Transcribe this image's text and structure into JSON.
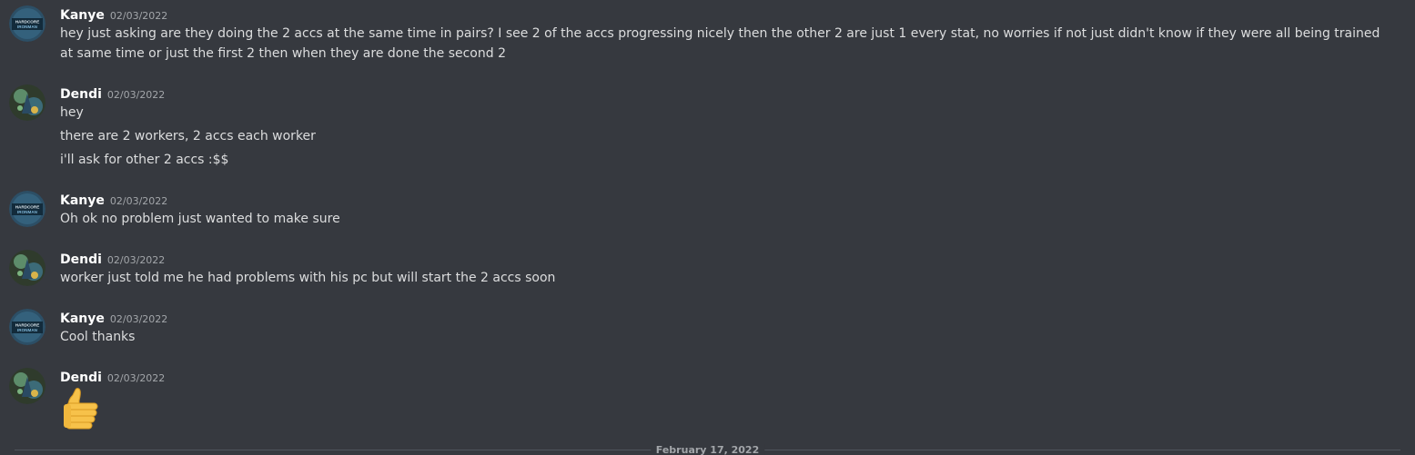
{
  "messages": [
    {
      "author": "Kanye",
      "timestamp": "02/03/2022",
      "avatar": "hardcore-ironman-icon",
      "lines": [
        "hey just asking are they doing the 2 accs at the same time in pairs? I see 2 of the accs progressing nicely then the other 2 are just 1 every stat, no worries if not just didn't know if they were all being trained at same time or just the first 2 then when they are done the second 2"
      ]
    },
    {
      "author": "Dendi",
      "timestamp": "02/03/2022",
      "avatar": "character-avatar",
      "lines": [
        "hey",
        "there are 2 workers, 2 accs each worker",
        "i'll ask for other 2 accs :$$"
      ]
    },
    {
      "author": "Kanye",
      "timestamp": "02/03/2022",
      "avatar": "hardcore-ironman-icon",
      "lines": [
        "Oh ok no problem just wanted to make sure"
      ]
    },
    {
      "author": "Dendi",
      "timestamp": "02/03/2022",
      "avatar": "character-avatar",
      "lines": [
        "worker just told me he had problems with his pc but will start the 2 accs soon"
      ]
    },
    {
      "author": "Kanye",
      "timestamp": "02/03/2022",
      "avatar": "hardcore-ironman-icon",
      "lines": [
        "Cool thanks"
      ]
    },
    {
      "author": "Dendi",
      "timestamp": "02/03/2022",
      "avatar": "character-avatar",
      "emoji": "thumbs-up-icon"
    }
  ],
  "avatar_text": {
    "line1": "HARDCORE",
    "line2": "IRONMAN"
  },
  "date_divider": "February 17, 2022",
  "colors": {
    "background": "#36393f",
    "username": "#ffffff",
    "timestamp": "#a3a6aa",
    "message_text": "#dcddde"
  }
}
